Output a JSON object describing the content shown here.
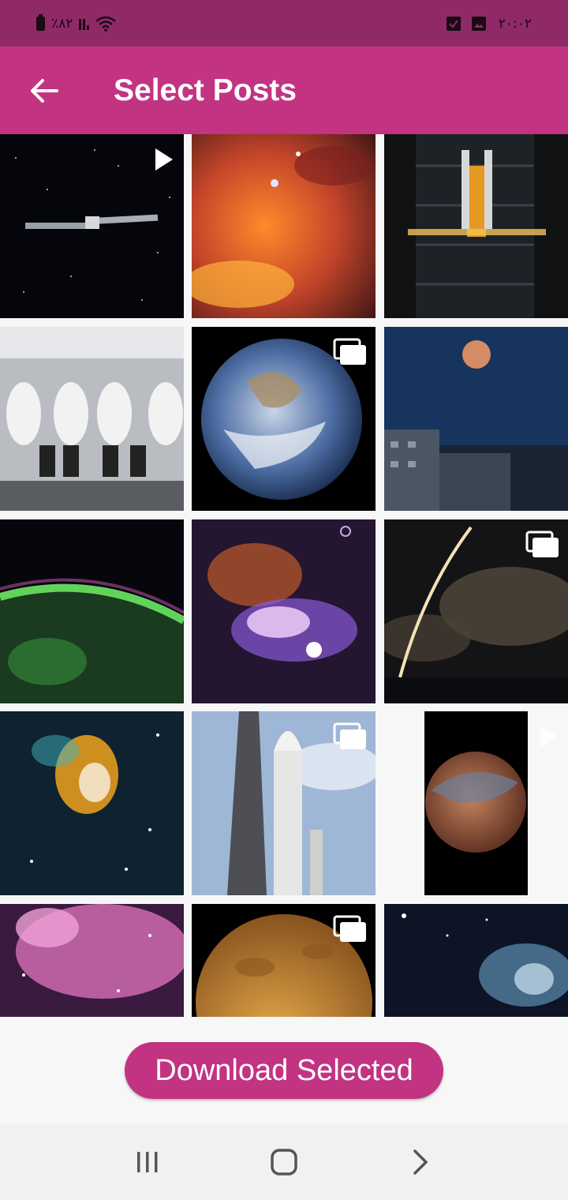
{
  "status_bar": {
    "battery_text": "٪۸۲",
    "time_text": "۲۰:۰۲",
    "icons": [
      "battery-icon",
      "signal-icon",
      "wifi-icon",
      "checkbox-notification-icon",
      "image-notification-icon"
    ]
  },
  "app_bar": {
    "title": "Select Posts",
    "back_icon": "arrow-left-icon"
  },
  "posts": [
    {
      "subject": "satellite in space",
      "badge": "play"
    },
    {
      "subject": "orange nebula",
      "badge": null
    },
    {
      "subject": "rocket assembly building",
      "badge": null
    },
    {
      "subject": "astronauts in capsule",
      "badge": null
    },
    {
      "subject": "earth",
      "badge": "gallery"
    },
    {
      "subject": "moon over city",
      "badge": null
    },
    {
      "subject": "aurora over earth",
      "badge": null
    },
    {
      "subject": "galactic center",
      "badge": null
    },
    {
      "subject": "rocket launch trail",
      "badge": "gallery"
    },
    {
      "subject": "supernova remnant",
      "badge": null
    },
    {
      "subject": "rocket on launch pad",
      "badge": "gallery"
    },
    {
      "subject": "mars planet",
      "badge": "play"
    },
    {
      "subject": "pink nebula",
      "badge": null
    },
    {
      "subject": "venus",
      "badge": "gallery"
    },
    {
      "subject": "blue nebula",
      "badge": null
    }
  ],
  "actions": {
    "download_label": "Download Selected"
  },
  "nav": {
    "recents_icon": "recents-icon",
    "home_icon": "home-icon",
    "back_icon": "chevron-right-icon"
  },
  "colors": {
    "status_bar": "#8f2a66",
    "primary": "#c23382",
    "background": "#f7f7f7"
  }
}
